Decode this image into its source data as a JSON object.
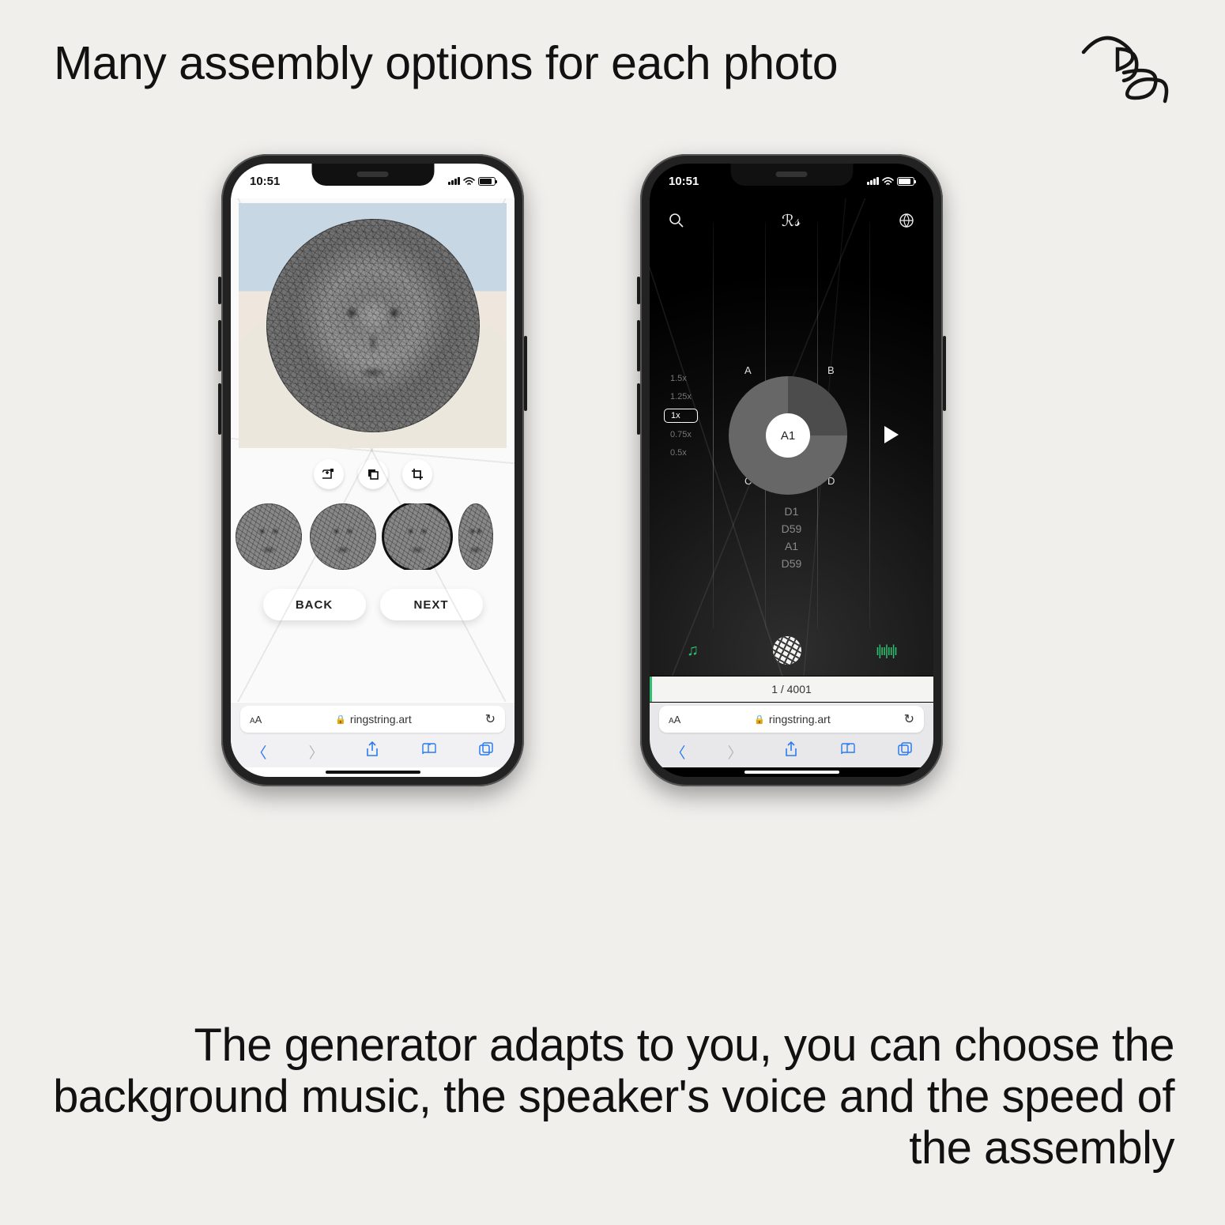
{
  "headline": "Many assembly options for each photo",
  "footer": "The generator adapts to you, you can choose the background music, the speaker's voice and the speed of the assembly",
  "logo_text": "RS",
  "status": {
    "time": "10:51"
  },
  "browser": {
    "url": "ringstring.art",
    "aa_small": "A",
    "aa_big": "A"
  },
  "left_screen": {
    "tools": {
      "add": "add-folder",
      "copy": "copy",
      "crop": "crop"
    },
    "buttons": {
      "back": "BACK",
      "next": "NEXT"
    }
  },
  "right_screen": {
    "speeds": [
      "1.5x",
      "1.25x",
      "1x",
      "0.75x",
      "0.5x"
    ],
    "active_speed_index": 2,
    "pegs": {
      "a": "A",
      "b": "B",
      "c": "C",
      "d": "D"
    },
    "current_peg": "A1",
    "steps": [
      "D1",
      "D59",
      "A1",
      "D59"
    ],
    "progress": "1 / 4001"
  }
}
